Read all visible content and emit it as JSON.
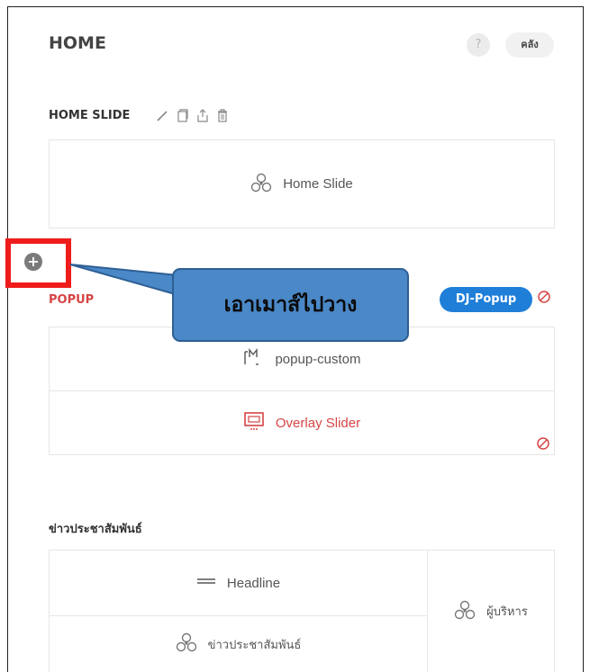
{
  "header": {
    "title": "HOME",
    "help_label": "?",
    "library_label": "คลัง"
  },
  "home_slide_section": {
    "title": "HOME SLIDE",
    "module_label": "Home Slide"
  },
  "popup_section": {
    "title": "POPUP",
    "badge_label": "DJ-Popup",
    "module_popup_custom": "popup-custom",
    "module_overlay_slider": "Overlay Slider"
  },
  "callout": {
    "text": "เอาเมาส์ไปวาง"
  },
  "add_marker": {
    "symbol": "+"
  },
  "news_section": {
    "title": "ข่าวประชาสัมพันธ์",
    "module_headline": "Headline",
    "module_news": "ข่าวประชาสัมพันธ์",
    "module_executives": "ผู้บริหาร"
  },
  "colors": {
    "accent_red": "#d64545",
    "pill_blue": "#1f7fd8",
    "callout_fill": "#4a88c7",
    "marker_red": "#ef1c1c"
  }
}
